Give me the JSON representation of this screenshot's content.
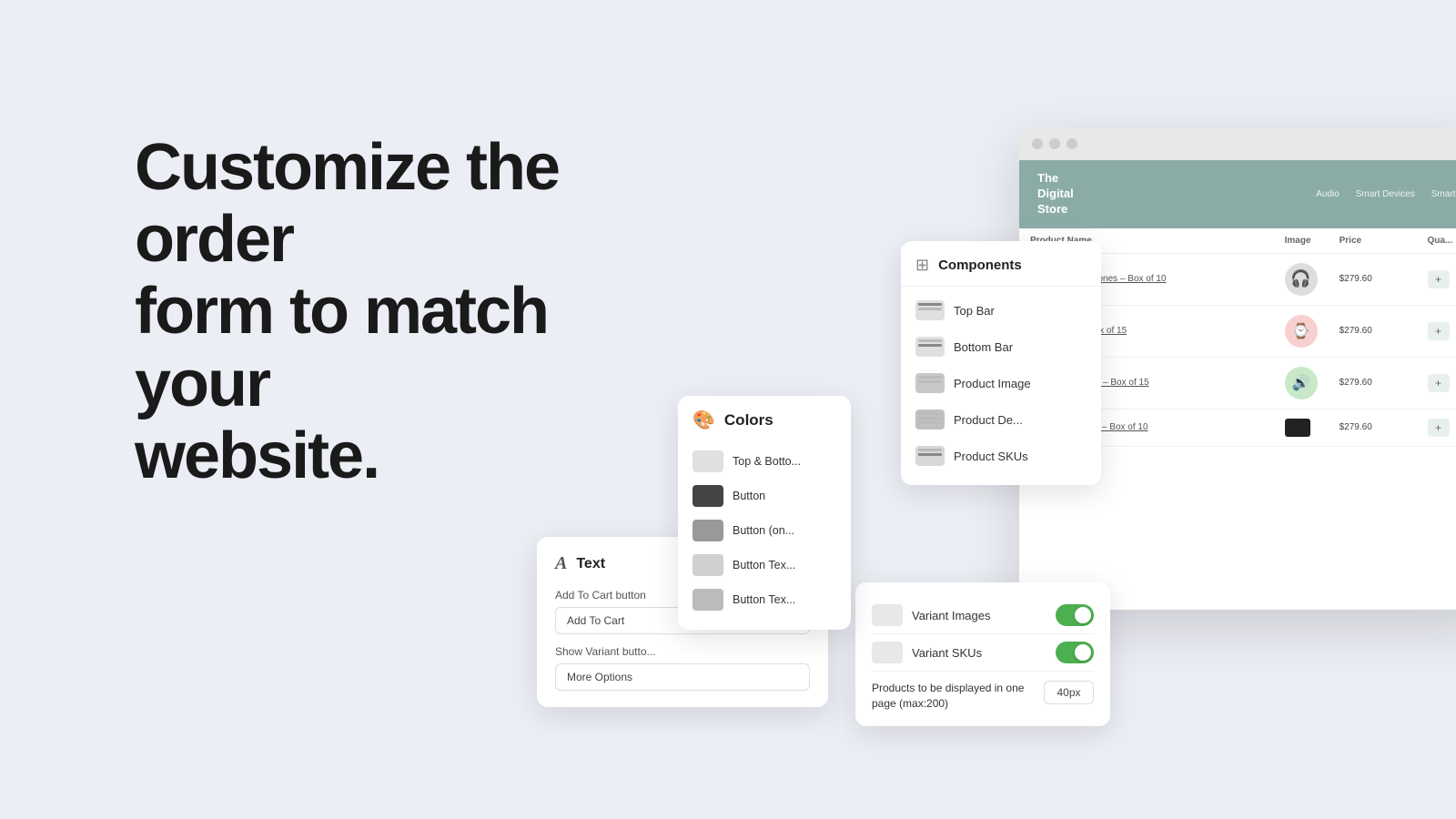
{
  "hero": {
    "title_line1": "Customize the order",
    "title_line2": "form to match your",
    "title_line3": "website."
  },
  "browser": {
    "dots": [
      "dot1",
      "dot2",
      "dot3"
    ],
    "store": {
      "logo_line1": "The",
      "logo_line2": "Digital",
      "logo_line3": "Store",
      "nav": [
        "Audio",
        "Smart Devices",
        "Smart Dev"
      ]
    },
    "table": {
      "headers": [
        "Product Name",
        "Image",
        "Price",
        "Qua..."
      ],
      "rows": [
        {
          "name": "Wireless headphones – Box of 10",
          "icon": "🎧",
          "price": "$279.60",
          "bg": "#ddd"
        },
        {
          "name": "Smart Band – Box of 15",
          "icon": "⌚",
          "price": "$279.60",
          "bg": "#f0c0c0"
        },
        {
          "name": "Portable Speaker – Box of 15",
          "icon": "🔊",
          "price": "$279.60",
          "bg": "#c0e0c0"
        },
        {
          "name": "Outdoor Speaker – Box of 10",
          "icon": "■",
          "price": "$279.60",
          "bg": "#222",
          "is_swatch": true
        }
      ]
    }
  },
  "components_panel": {
    "title": "Components",
    "items": [
      {
        "label": "Top Bar",
        "id": "top-bar"
      },
      {
        "label": "Bottom Bar",
        "id": "bottom-bar"
      },
      {
        "label": "Product Image",
        "id": "product-image"
      },
      {
        "label": "Product De...",
        "id": "product-description"
      },
      {
        "label": "Product SKUs",
        "id": "product-skus"
      }
    ]
  },
  "colors_panel": {
    "title": "Colors",
    "items": [
      {
        "label": "Top & Botto...",
        "id": "top-bottom"
      },
      {
        "label": "Button",
        "id": "button"
      },
      {
        "label": "Button (on...",
        "id": "button-on"
      },
      {
        "label": "Button Tex...",
        "id": "button-text1"
      },
      {
        "label": "Button Tex...",
        "id": "button-text2"
      }
    ]
  },
  "text_panel": {
    "title": "Text",
    "icon": "A",
    "add_to_cart_label": "Add To Cart button",
    "add_to_cart_value": "Add To Cart",
    "show_variant_label": "Show Variant butto...",
    "show_variant_value": "More Options"
  },
  "variants_panel": {
    "rows": [
      {
        "label": "Variant Images",
        "toggled": true
      },
      {
        "label": "Variant SKUs",
        "toggled": true
      }
    ],
    "products_per_page_label": "Products to be displayed in one page (max:200)",
    "products_per_page_value": "40px"
  }
}
